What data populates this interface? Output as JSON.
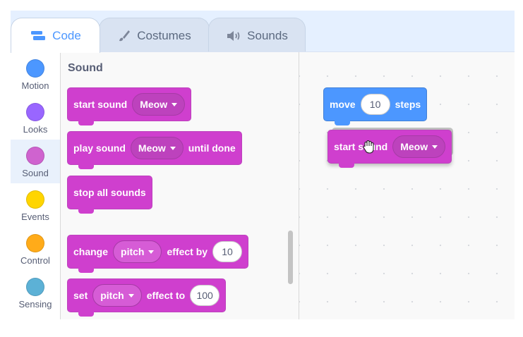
{
  "tabs": [
    {
      "label": "Code",
      "icon": "code-icon",
      "active": true
    },
    {
      "label": "Costumes",
      "icon": "brush-icon",
      "active": false
    },
    {
      "label": "Sounds",
      "icon": "speaker-icon",
      "active": false
    }
  ],
  "categories": [
    {
      "label": "Motion",
      "color": "#4c97ff"
    },
    {
      "label": "Looks",
      "color": "#9966ff"
    },
    {
      "label": "Sound",
      "color": "#cf63cf",
      "selected": true
    },
    {
      "label": "Events",
      "color": "#ffd500"
    },
    {
      "label": "Control",
      "color": "#ffab19"
    },
    {
      "label": "Sensing",
      "color": "#5cb1d6"
    }
  ],
  "palette": {
    "title": "Sound",
    "blocks": {
      "start_sound": {
        "text": "start sound",
        "menu": "Meow"
      },
      "play_sound": {
        "text": "play sound",
        "menu": "Meow",
        "suffix": "until done"
      },
      "stop_all": {
        "text": "stop all sounds"
      },
      "change_effect": {
        "text": "change",
        "menu": "pitch",
        "suffix": "effect by",
        "value": "10"
      },
      "set_effect": {
        "text": "set",
        "menu": "pitch",
        "suffix": "effect to",
        "value": "100"
      }
    }
  },
  "workspace": {
    "move_block": {
      "text": "move",
      "value": "10",
      "suffix": "steps"
    },
    "dragged_block": {
      "text": "start sound",
      "menu": "Meow"
    }
  },
  "colors": {
    "motion": "#4c97ff",
    "sound": "#cf63cf",
    "accent": "#4c97ff"
  }
}
